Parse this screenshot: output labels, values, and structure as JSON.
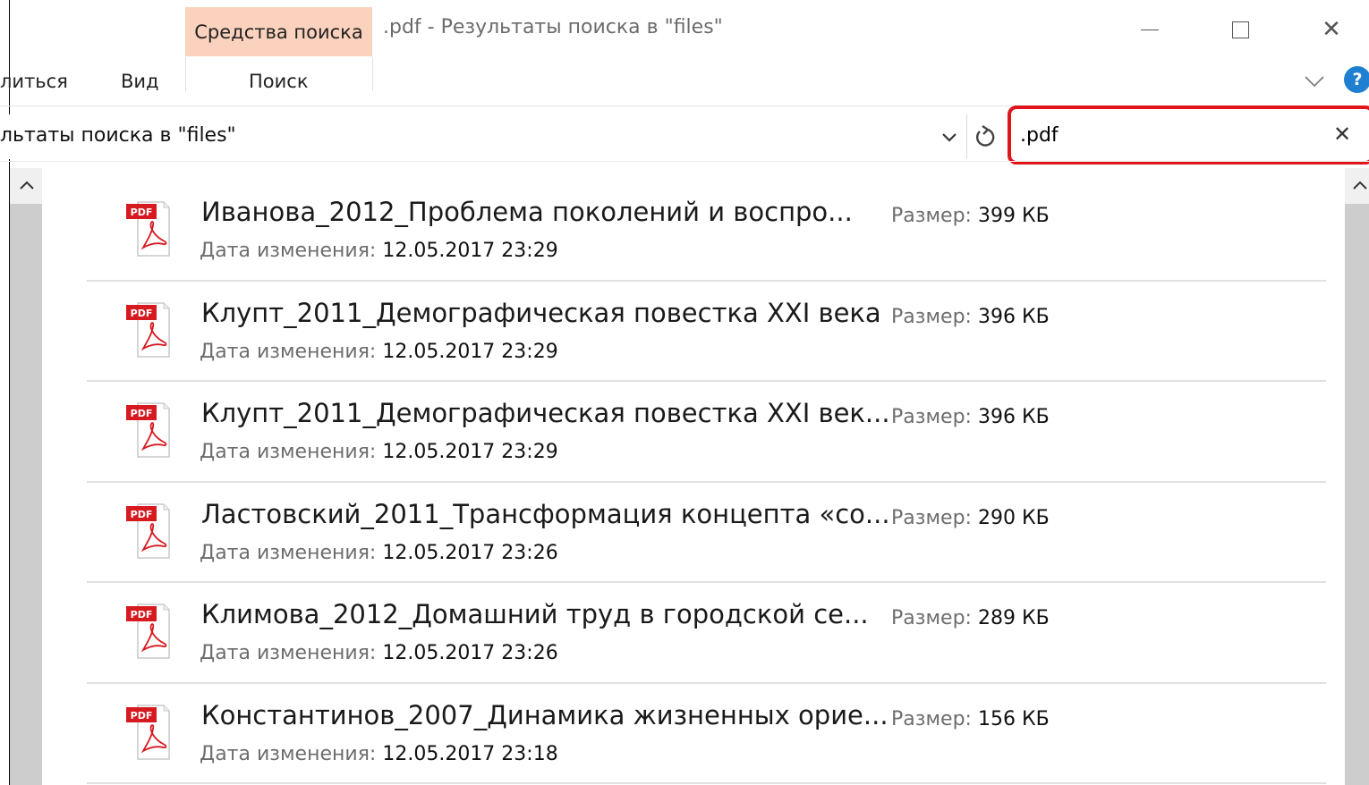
{
  "window": {
    "title": ".pdf - Результаты поиска в \"files\"",
    "context_group": "Средства поиска"
  },
  "ribbon": {
    "tabs": [
      {
        "label": "литься"
      },
      {
        "label": "Вид"
      },
      {
        "label": "Поиск"
      }
    ]
  },
  "address": {
    "path": "льтаты поиска в \"files\""
  },
  "search": {
    "value": ".pdf",
    "clear_label": "✕"
  },
  "help_label": "?",
  "labels": {
    "size": "Размер:",
    "modified": "Дата изменения:",
    "pdf_badge": "PDF"
  },
  "files": [
    {
      "name": "Иванова_2012_Проблема поколений и воспро...",
      "modified": "12.05.2017 23:29",
      "size": "399 КБ"
    },
    {
      "name": "Клупт_2011_Демографическая повестка XXI века",
      "modified": "12.05.2017 23:29",
      "size": "396 КБ"
    },
    {
      "name": "Клупт_2011_Демографическая повестка XXI век...",
      "modified": "12.05.2017 23:29",
      "size": "396 КБ"
    },
    {
      "name": "Ластовский_2011_Трансформация концепта «со...",
      "modified": "12.05.2017 23:26",
      "size": "290 КБ"
    },
    {
      "name": "Климова_2012_Домашний труд в городской се...",
      "modified": "12.05.2017 23:26",
      "size": "289 КБ"
    },
    {
      "name": "Константинов_2007_Динамика жизненных орие...",
      "modified": "12.05.2017 23:18",
      "size": "156 КБ"
    }
  ],
  "colors": {
    "context_tab": "#fbd2bd",
    "search_highlight": "#e0141b",
    "pdf_red": "#d71920",
    "help_blue": "#1f7fd0"
  }
}
